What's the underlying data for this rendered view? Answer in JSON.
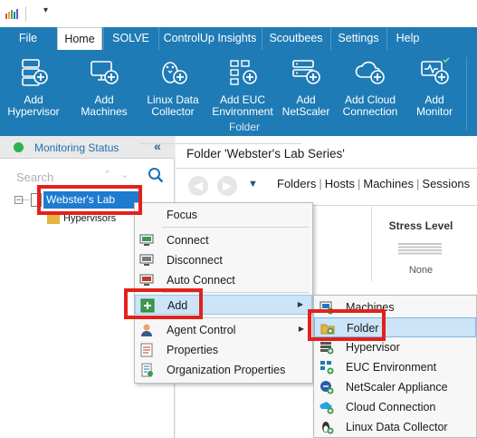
{
  "tabs": [
    {
      "label": "File"
    },
    {
      "label": "Home"
    },
    {
      "label": "SOLVE"
    },
    {
      "label": "ControlUp Insights"
    },
    {
      "label": "Scoutbees"
    },
    {
      "label": "Settings"
    },
    {
      "label": "Help"
    }
  ],
  "ribbon": {
    "buttons": [
      {
        "label": "Add\nHypervisor",
        "icon": "add-hypervisor-icon"
      },
      {
        "label": "Add\nMachines",
        "icon": "add-machines-icon"
      },
      {
        "label": "Linux Data\nCollector",
        "icon": "linux-penguin-icon"
      },
      {
        "label": "Add EUC\nEnvironment",
        "icon": "add-euc-icon"
      },
      {
        "label": "Add\nNetScaler",
        "icon": "add-netscaler-icon"
      },
      {
        "label": "Add Cloud\nConnection",
        "icon": "add-cloud-icon"
      },
      {
        "label": "Add\nMonitor",
        "icon": "add-monitor-icon"
      }
    ],
    "group_label": "Folder"
  },
  "left_pane": {
    "title": "Monitoring Status",
    "collapse": "«",
    "search_placeholder": "Search",
    "tree": {
      "root": "Webster's Lab Series",
      "child": "Hypervisors"
    }
  },
  "right_pane": {
    "title": "Folder 'Webster's Lab Series'",
    "links": [
      "Folders",
      "Hosts",
      "Machines",
      "Sessions"
    ],
    "column_header": "Stress Level",
    "column_value": "None"
  },
  "context_menu": {
    "items": [
      {
        "label": "Focus",
        "icon": "focus-icon"
      },
      {
        "label": "Connect",
        "icon": "connect-icon"
      },
      {
        "label": "Disconnect",
        "icon": "disconnect-icon"
      },
      {
        "label": "Auto Connect",
        "icon": "auto-connect-icon"
      },
      {
        "label": "Add",
        "icon": "add-icon",
        "submenu": true
      },
      {
        "label": "Agent Control",
        "icon": "agent-control-icon",
        "submenu": true
      },
      {
        "label": "Properties",
        "icon": "properties-icon"
      },
      {
        "label": "Organization Properties",
        "icon": "organization-properties-icon"
      }
    ]
  },
  "add_submenu": {
    "items": [
      {
        "label": "Machines",
        "icon": "machines-icon"
      },
      {
        "label": "Folder",
        "icon": "folder-icon"
      },
      {
        "label": "Hypervisor",
        "icon": "hypervisor-icon"
      },
      {
        "label": "EUC Environment",
        "icon": "euc-environment-icon"
      },
      {
        "label": "NetScaler Appliance",
        "icon": "netscaler-icon"
      },
      {
        "label": "Cloud Connection",
        "icon": "cloud-connection-icon"
      },
      {
        "label": "Linux Data Collector",
        "icon": "linux-collector-icon"
      }
    ]
  },
  "colors": {
    "ribbon": "#1e7bb5",
    "selection": "#1e7bd0",
    "highlight_box": "#e3211c",
    "menu_hover": "#cce4f7"
  }
}
